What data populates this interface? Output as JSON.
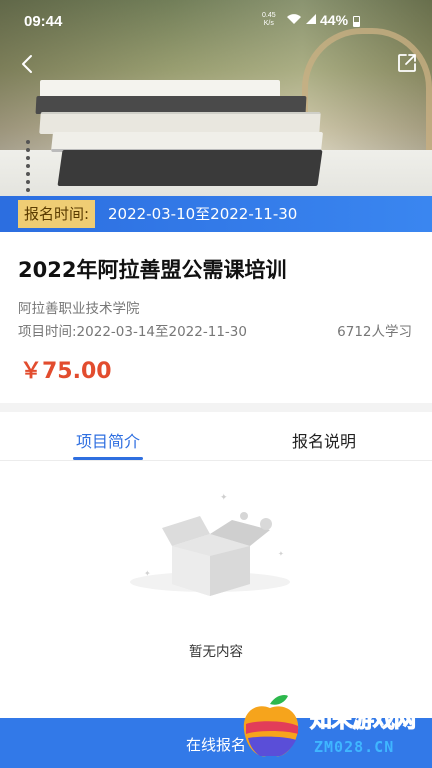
{
  "status_bar": {
    "time": "09:44",
    "net_speed_value": "0.45",
    "net_speed_unit": "K/s",
    "battery": "44%"
  },
  "header": {
    "back_icon": "back-arrow-icon",
    "share_icon": "share-icon"
  },
  "registration": {
    "label": "报名时间:",
    "date_range": "2022-03-10至2022-11-30"
  },
  "course": {
    "title": "2022年阿拉善盟公需课培训",
    "organization": "阿拉善职业技术学院",
    "project_time": "项目时间:2022-03-14至2022-11-30",
    "learners": "6712人学习",
    "price": "￥75.00"
  },
  "tabs": [
    {
      "label": "项目简介",
      "active": true
    },
    {
      "label": "报名说明",
      "active": false
    }
  ],
  "empty_state": {
    "icon": "empty-box-icon",
    "text": "暂无内容"
  },
  "footer": {
    "cta_label": "在线报名"
  },
  "watermark": {
    "site_name": "知末游戏网",
    "url": "ZM028.CN"
  },
  "colors": {
    "accent": "#3279e8",
    "price": "#e24c2e",
    "reg_tag_bg": "#fad26e"
  }
}
